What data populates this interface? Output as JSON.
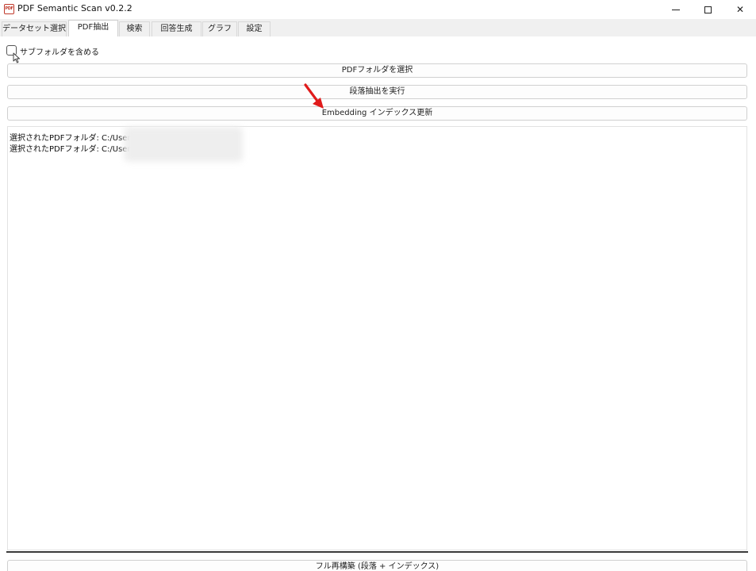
{
  "window": {
    "icon_text": "PDF",
    "title": "PDF Semantic Scan v0.2.2",
    "controls": {
      "minimize": "minimize-icon",
      "maximize": "maximize-icon",
      "close": "close-icon",
      "close_glyph": "✕"
    }
  },
  "tabs": [
    {
      "label": "データセット選択",
      "active": false
    },
    {
      "label": "PDF抽出",
      "active": true
    },
    {
      "label": "検索",
      "active": false
    },
    {
      "label": "回答生成",
      "active": false
    },
    {
      "label": "グラフ",
      "active": false
    },
    {
      "label": "設定",
      "active": false
    }
  ],
  "extract": {
    "include_subfolders_label": "サブフォルダを含める",
    "include_subfolders_checked": false,
    "select_folder_label": "PDFフォルダを選択",
    "run_extraction_label": "段落抽出を実行",
    "update_index_label": "Embedding インデックス更新",
    "full_rebuild_label": "フル再構築 (段落 + インデックス)",
    "log": [
      "選択されたPDFフォルダ: C:/Users/",
      "選択されたPDFフォルダ: C:/Users/"
    ]
  },
  "annotation": {
    "arrow_color": "#e01b1b"
  }
}
